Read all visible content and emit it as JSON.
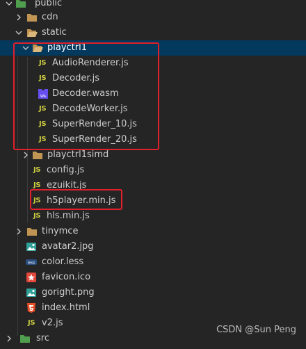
{
  "explorer": {
    "items": [
      {
        "label": "public",
        "type": "folder",
        "state": "open"
      },
      {
        "label": "cdn",
        "type": "folder",
        "state": "closed"
      },
      {
        "label": "static",
        "type": "folder",
        "state": "open"
      },
      {
        "label": "playctrl1",
        "type": "folder",
        "state": "open",
        "selected": true
      },
      {
        "label": "AudioRenderer.js",
        "type": "js"
      },
      {
        "label": "Decoder.js",
        "type": "js"
      },
      {
        "label": "Decoder.wasm",
        "type": "wasm"
      },
      {
        "label": "DecodeWorker.js",
        "type": "js"
      },
      {
        "label": "SuperRender_10.js",
        "type": "js"
      },
      {
        "label": "SuperRender_20.js",
        "type": "js"
      },
      {
        "label": "playctrl1simd",
        "type": "folder",
        "state": "closed"
      },
      {
        "label": "config.js",
        "type": "js"
      },
      {
        "label": "ezuikit.js",
        "type": "js"
      },
      {
        "label": "h5player.min.js",
        "type": "js"
      },
      {
        "label": "hls.min.js",
        "type": "js"
      },
      {
        "label": "tinymce",
        "type": "folder",
        "state": "closed"
      },
      {
        "label": "avatar2.jpg",
        "type": "image"
      },
      {
        "label": "color.less",
        "type": "less"
      },
      {
        "label": "favicon.ico",
        "type": "ico"
      },
      {
        "label": "goright.png",
        "type": "image"
      },
      {
        "label": "index.html",
        "type": "html"
      },
      {
        "label": "v2.js",
        "type": "js"
      },
      {
        "label": "src",
        "type": "folder-src",
        "state": "closed"
      }
    ],
    "js_badge": "JS",
    "wasm_badge": "WA",
    "less_badge": "less"
  },
  "watermark": "CSDN @Sun   Peng",
  "colors": {
    "background": "#252526",
    "selection": "#04395e",
    "highlight_box": "#e0202a",
    "js_icon": "#cbcb41",
    "folder_icon": "#c09553"
  }
}
